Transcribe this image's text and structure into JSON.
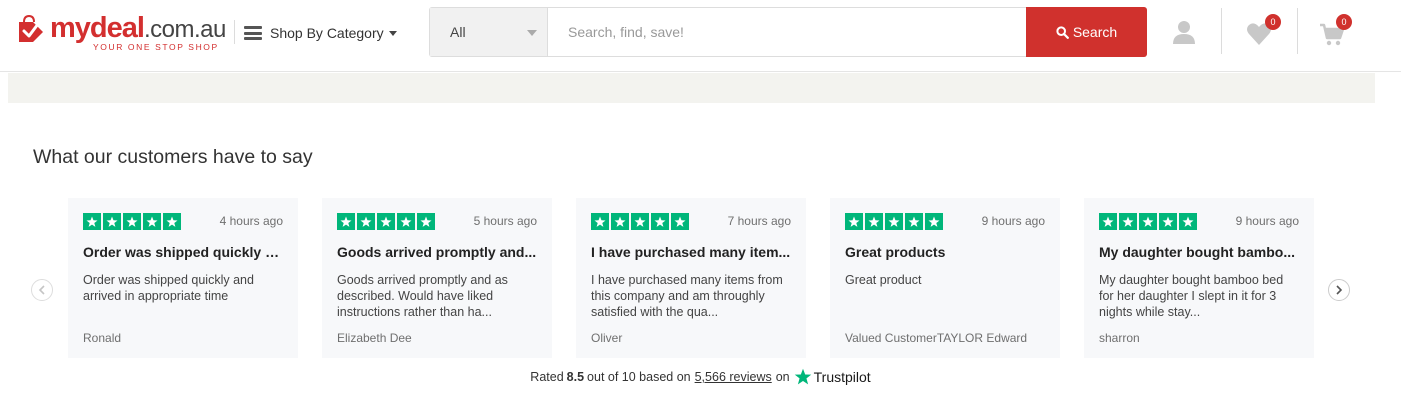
{
  "header": {
    "logo": {
      "brand_my": "my",
      "brand_deal": "deal",
      "brand_tld": ".com.au",
      "tagline": "YOUR ONE STOP SHOP"
    },
    "shop_by_category": "Shop By Category",
    "search": {
      "category_selected": "All",
      "placeholder": "Search, find, save!",
      "button_label": "Search"
    },
    "wishlist_count": "0",
    "cart_count": "0",
    "icons": [
      "user-icon",
      "heart-icon",
      "cart-icon",
      "search-icon",
      "menu-icon"
    ]
  },
  "reviews_section": {
    "title": "What our customers have to say",
    "reviews": [
      {
        "stars": 5,
        "time": "4 hours ago",
        "title": "Order was shipped quickly a...",
        "body": "Order was shipped quickly and arrived in appropriate time",
        "author": "Ronald"
      },
      {
        "stars": 5,
        "time": "5 hours ago",
        "title": "Goods arrived promptly and...",
        "body": "Goods arrived promptly and as described. Would have liked instructions rather than ha...",
        "author": "Elizabeth Dee"
      },
      {
        "stars": 5,
        "time": "7 hours ago",
        "title": "I have purchased many item...",
        "body": "I have purchased many items from this company and am throughly satisfied with the qua...",
        "author": "Oliver"
      },
      {
        "stars": 5,
        "time": "9 hours ago",
        "title": "Great products",
        "body": "Great product",
        "author": "Valued CustomerTAYLOR Edward"
      },
      {
        "stars": 5,
        "time": "9 hours ago",
        "title": "My daughter bought bambo...",
        "body": "My daughter bought bamboo bed for her daughter I slept in it for 3 nights while stay...",
        "author": "sharron"
      }
    ],
    "rating_summary": {
      "prefix": "Rated",
      "score": "8.5",
      "mid": "out of 10 based on",
      "reviews_link": "5,566 reviews",
      "on": "on",
      "provider": "Trustpilot"
    }
  },
  "colors": {
    "brand_red": "#d0312d",
    "trustpilot_green": "#00b67a"
  }
}
